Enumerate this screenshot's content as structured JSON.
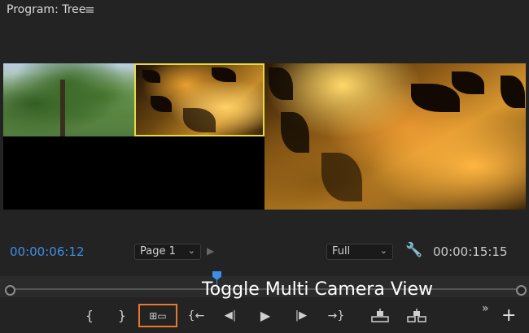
{
  "panel": {
    "title": "Program: Tree",
    "menu_icon": "hamburger-menu-icon"
  },
  "controls": {
    "current_timecode": "00:00:06:12",
    "duration_timecode": "00:00:15:15",
    "page_select": "Page 1",
    "resolution_select": "Full",
    "playhead_position": 0.405
  },
  "tooltip": {
    "text": "Toggle Multi Camera View"
  },
  "transport": {
    "buttons": [
      {
        "name": "mark-in",
        "icon": "{"
      },
      {
        "name": "mark-out",
        "icon": "}"
      },
      {
        "name": "toggle-multi-camera-view",
        "icon": "⊞▭"
      },
      {
        "name": "go-to-in",
        "icon": "{←"
      },
      {
        "name": "step-back",
        "icon": "◀|"
      },
      {
        "name": "play",
        "icon": "▶"
      },
      {
        "name": "step-forward",
        "icon": "|▶"
      },
      {
        "name": "go-to-out",
        "icon": "→}"
      },
      {
        "name": "lift",
        "icon": "lift-icon"
      },
      {
        "name": "extract",
        "icon": "extract-icon"
      },
      {
        "name": "more",
        "icon": "»"
      },
      {
        "name": "add",
        "icon": "+"
      }
    ]
  },
  "colors": {
    "timecode_blue": "#3d8ee6",
    "selected_camera_border": "#e8d940",
    "highlight_orange": "#e8782a"
  }
}
